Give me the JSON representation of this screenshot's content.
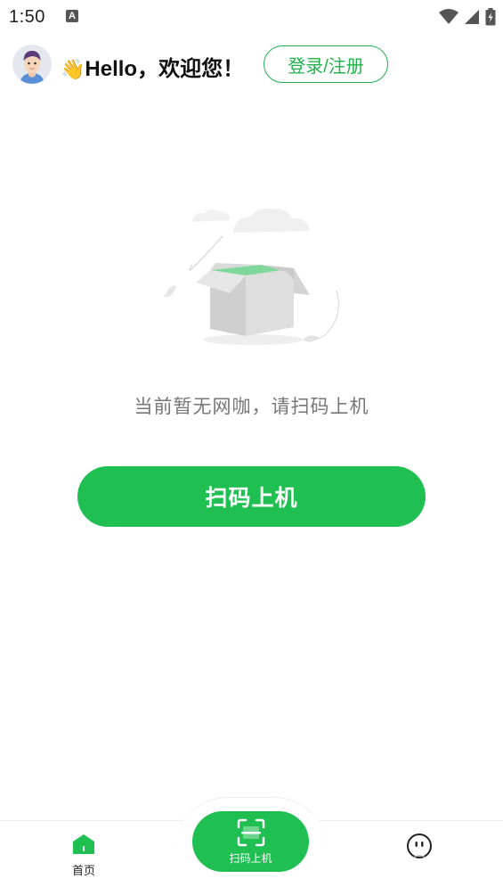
{
  "status_bar": {
    "time": "1:50",
    "notification_icon": "a-notification-icon",
    "icons": [
      "wifi-icon",
      "signal-icon",
      "battery-icon"
    ]
  },
  "header": {
    "greeting_emoji": "👋",
    "greeting": "Hello，欢迎您！",
    "login_label": "登录/注册"
  },
  "empty_state": {
    "illustration": "empty-box-illustration",
    "message": "当前暂无网咖，请扫码上机"
  },
  "main": {
    "scan_button_label": "扫码上机"
  },
  "bottom_nav": {
    "items": [
      {
        "label": "首页",
        "icon": "home-icon"
      },
      {
        "label": "扫码上机",
        "icon": "scan-icon"
      },
      {
        "label": "",
        "icon": "profile-face-icon"
      }
    ]
  },
  "colors": {
    "accent": "#1fbf52",
    "accent_outline": "#22b14c",
    "muted_text": "#777777"
  }
}
